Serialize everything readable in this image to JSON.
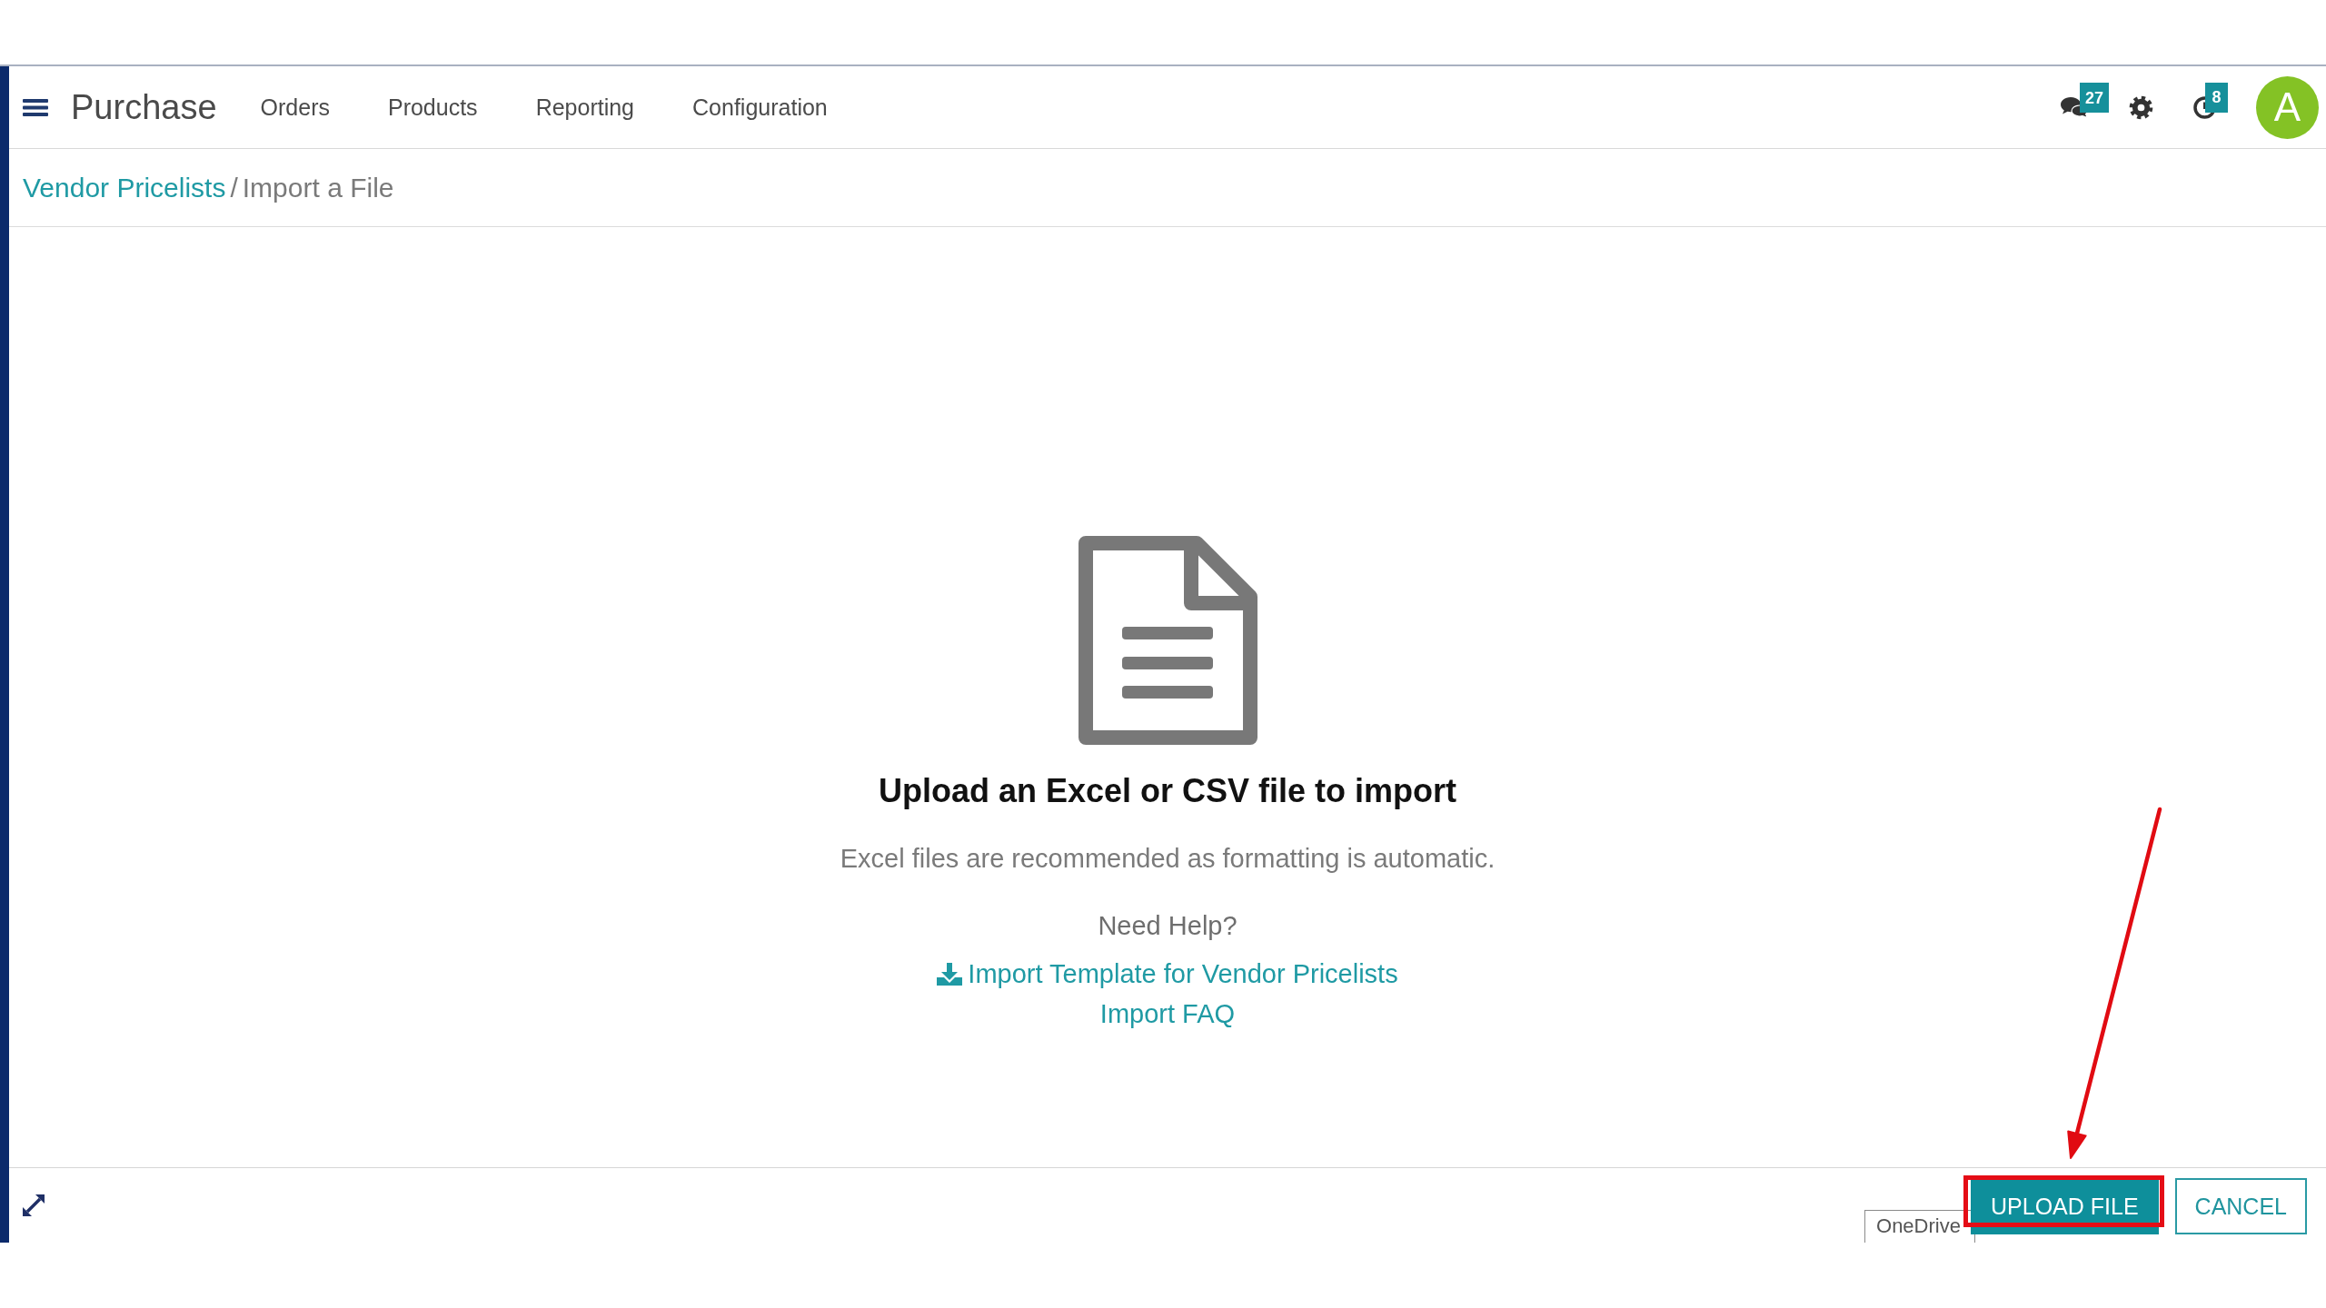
{
  "navbar": {
    "app_name": "Purchase",
    "menu": [
      "Orders",
      "Products",
      "Reporting",
      "Configuration"
    ],
    "notifications": [
      {
        "kind": "messages",
        "count": "27"
      },
      {
        "kind": "settings"
      },
      {
        "kind": "activities",
        "count": "8"
      }
    ],
    "user": {
      "initial": "A"
    }
  },
  "breadcrumb": {
    "separator": "/",
    "items": [
      {
        "label": "Vendor Pricelists",
        "current": false
      },
      {
        "label": "Import a File",
        "current": true
      }
    ]
  },
  "import_panel": {
    "title": "Upload an Excel or CSV file to import",
    "hint": "Excel files are recommended as formatting is automatic.",
    "help_label": "Need Help?",
    "links": [
      {
        "kind": "download",
        "label": "Import Template for Vendor Pricelists"
      },
      {
        "kind": "plain",
        "label": "Import FAQ"
      }
    ]
  },
  "footer": {
    "buttons": [
      {
        "kind": "primary",
        "label": "UPLOAD FILE",
        "highlighted": true
      },
      {
        "kind": "secondary",
        "label": "CANCEL",
        "highlighted": false
      }
    ],
    "tooltip": "OneDrive"
  }
}
